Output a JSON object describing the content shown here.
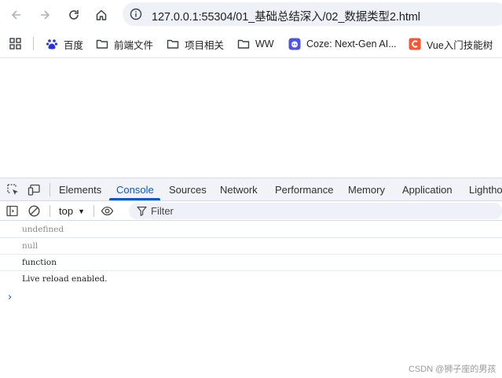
{
  "browser": {
    "url": "127.0.0.1:55304/01_基础总结深入/02_数据类型2.html",
    "bookmarks": [
      {
        "label": "百度",
        "icon": "baidu-icon"
      },
      {
        "label": "前端文件",
        "icon": "folder-icon"
      },
      {
        "label": "项目相关",
        "icon": "folder-icon"
      },
      {
        "label": "WW",
        "icon": "folder-icon"
      },
      {
        "label": "Coze: Next-Gen AI...",
        "icon": "coze-icon"
      },
      {
        "label": "Vue入门技能树",
        "icon": "csdn-icon"
      }
    ]
  },
  "devtools": {
    "tabs": [
      "Elements",
      "Console",
      "Sources",
      "Network",
      "Performance",
      "Memory",
      "Application",
      "Lighthouse"
    ],
    "active_tab": "Console",
    "context": "top",
    "filter_placeholder": "Filter",
    "messages": [
      {
        "text": "undefined",
        "style": "grey"
      },
      {
        "text": "null",
        "style": "grey"
      },
      {
        "text": "function",
        "style": "black"
      },
      {
        "text": "Live reload enabled.",
        "style": "black"
      }
    ],
    "prompt": "›"
  },
  "watermark": "CSDN @狮子座的男孩",
  "colors": {
    "accent": "#0b57d0",
    "toolbar_bg": "#f1f3f9",
    "omnibox_bg": "#eef1f8"
  }
}
